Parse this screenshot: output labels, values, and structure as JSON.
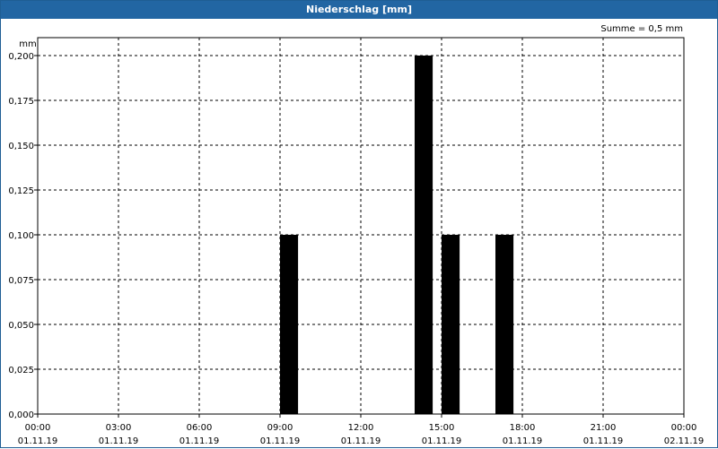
{
  "window": {
    "title": "Niederschlag [mm]"
  },
  "summary": {
    "text": "Summe = 0,5 mm"
  },
  "chart_data": {
    "type": "bar",
    "title": "Niederschlag [mm]",
    "ylabel": "mm",
    "xlabel": "",
    "ylim": [
      0,
      0.2
    ],
    "xlim_hours": [
      0,
      24
    ],
    "grid": true,
    "bar_color": "#000000",
    "y_ticks": [
      {
        "value": 0,
        "label": "0,000"
      },
      {
        "value": 0.025,
        "label": "0,025"
      },
      {
        "value": 0.05,
        "label": "0,050"
      },
      {
        "value": 0.075,
        "label": "0,075"
      },
      {
        "value": 0.1,
        "label": "0,100"
      },
      {
        "value": 0.125,
        "label": "0,125"
      },
      {
        "value": 0.15,
        "label": "0,150"
      },
      {
        "value": 0.175,
        "label": "0,175"
      },
      {
        "value": 0.2,
        "label": "0,200"
      }
    ],
    "x_ticks": [
      {
        "hour": 0,
        "time": "00:00",
        "date": "01.11.19"
      },
      {
        "hour": 3,
        "time": "03:00",
        "date": "01.11.19"
      },
      {
        "hour": 6,
        "time": "06:00",
        "date": "01.11.19"
      },
      {
        "hour": 9,
        "time": "09:00",
        "date": "01.11.19"
      },
      {
        "hour": 12,
        "time": "12:00",
        "date": "01.11.19"
      },
      {
        "hour": 15,
        "time": "15:00",
        "date": "01.11.19"
      },
      {
        "hour": 18,
        "time": "18:00",
        "date": "01.11.19"
      },
      {
        "hour": 21,
        "time": "21:00",
        "date": "01.11.19"
      },
      {
        "hour": 24,
        "time": "00:00",
        "date": "02.11.19"
      }
    ],
    "series": [
      {
        "values": [
          {
            "start_hour": 9.0,
            "end_hour": 9.67,
            "value": 0.1
          },
          {
            "start_hour": 14.0,
            "end_hour": 14.67,
            "value": 0.2
          },
          {
            "start_hour": 15.0,
            "end_hour": 15.67,
            "value": 0.1
          },
          {
            "start_hour": 17.0,
            "end_hour": 17.67,
            "value": 0.1
          }
        ]
      }
    ]
  }
}
